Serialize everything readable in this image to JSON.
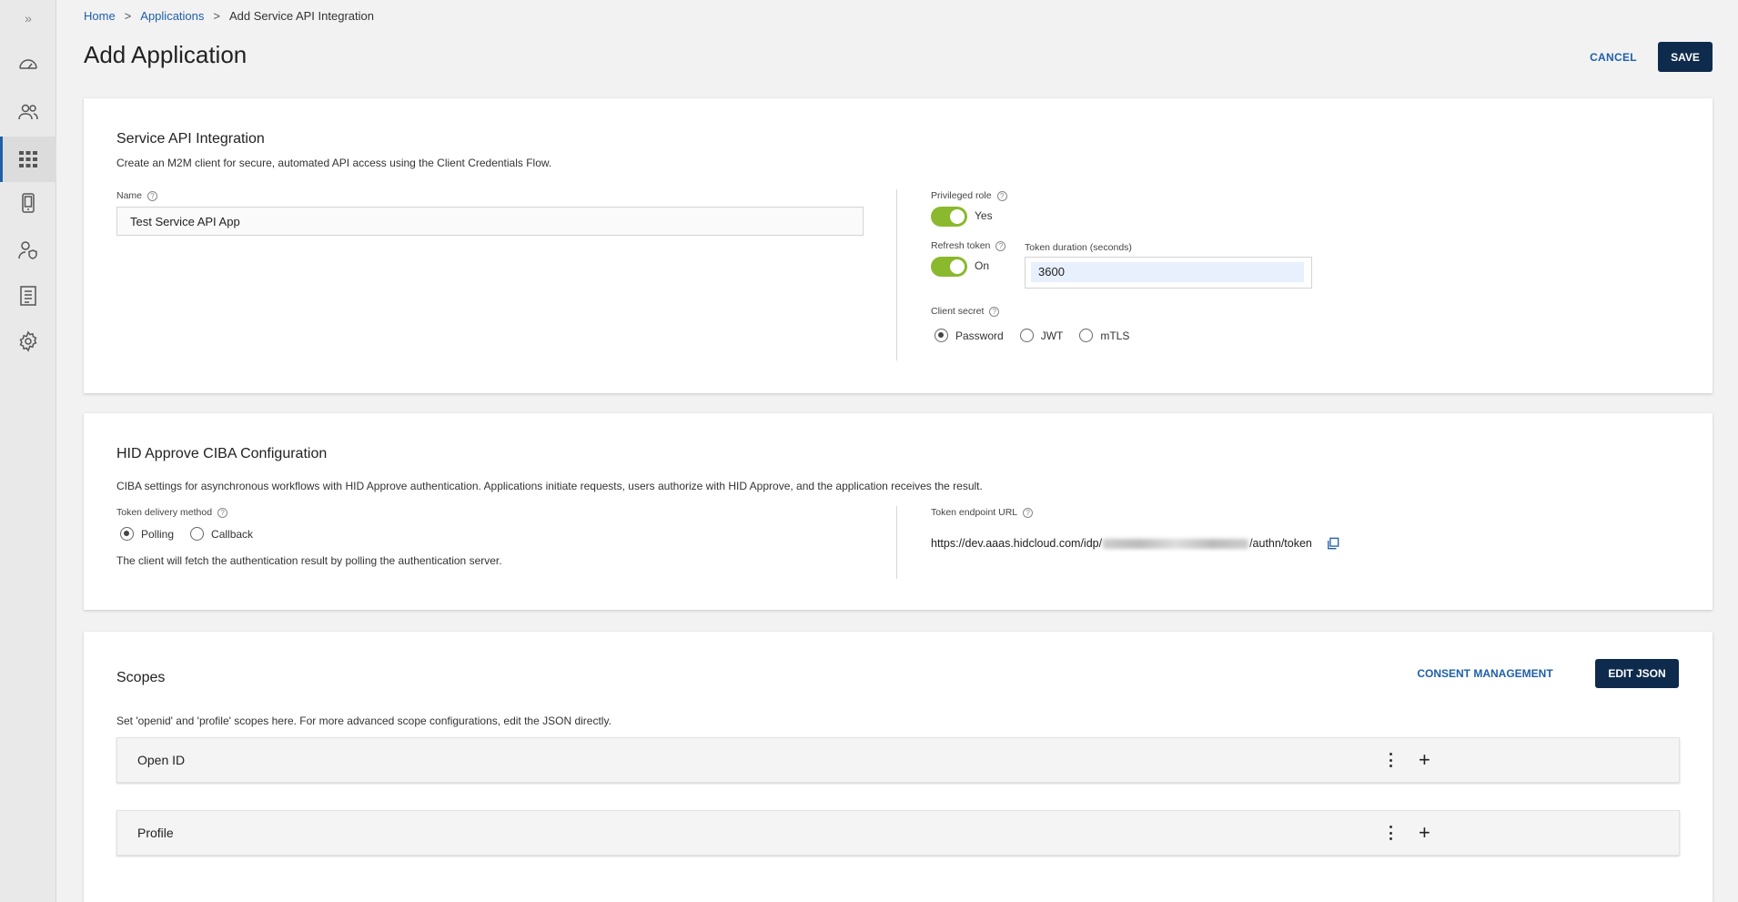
{
  "sidebar": {
    "toggle": "»",
    "items": [
      {
        "icon": "dashboard-icon"
      },
      {
        "icon": "users-icon"
      },
      {
        "icon": "applications-grid-icon",
        "active": true
      },
      {
        "icon": "device-icon"
      },
      {
        "icon": "user-shield-icon"
      },
      {
        "icon": "reports-icon"
      },
      {
        "icon": "settings-icon"
      }
    ]
  },
  "breadcrumb": {
    "home": "Home",
    "applications": "Applications",
    "current": "Add Service API Integration",
    "separator": ">"
  },
  "header": {
    "title": "Add Application",
    "cancel_label": "CANCEL",
    "save_label": "SAVE"
  },
  "service_api": {
    "title": "Service API Integration",
    "description": "Create an M2M client for secure, automated API access using the Client Credentials Flow.",
    "name_label": "Name",
    "name_value": "Test Service API App",
    "privileged_role_label": "Privileged role",
    "privileged_role_state": "Yes",
    "refresh_token_label": "Refresh token",
    "refresh_token_state": "On",
    "token_duration_label": "Token duration (seconds)",
    "token_duration_value": "3600",
    "client_secret_label": "Client secret",
    "client_secret_options": [
      "Password",
      "JWT",
      "mTLS"
    ],
    "client_secret_selected": "Password"
  },
  "ciba": {
    "title": "HID Approve CIBA Configuration",
    "description": "CIBA settings for asynchronous workflows with HID Approve authentication. Applications initiate requests, users authorize with HID Approve, and the application receives the result.",
    "delivery_label": "Token delivery method",
    "delivery_options": [
      "Polling",
      "Callback"
    ],
    "delivery_selected": "Polling",
    "delivery_note": "The client will fetch the authentication result by polling the authentication server.",
    "endpoint_label": "Token endpoint URL",
    "endpoint_prefix": "https://dev.aaas.hidcloud.com/idp/",
    "endpoint_suffix": "/authn/token"
  },
  "scopes": {
    "title": "Scopes",
    "description": "Set 'openid' and 'profile' scopes here. For more advanced scope configurations, edit the JSON directly.",
    "consent_label": "CONSENT MANAGEMENT",
    "edit_json_label": "EDIT JSON",
    "items": [
      {
        "label": "Open ID"
      },
      {
        "label": "Profile"
      }
    ],
    "add_symbol": "+"
  },
  "colors": {
    "accent": "#1f5fa8",
    "primary_button": "#0e2b4d",
    "toggle_on": "#8ab92d"
  }
}
